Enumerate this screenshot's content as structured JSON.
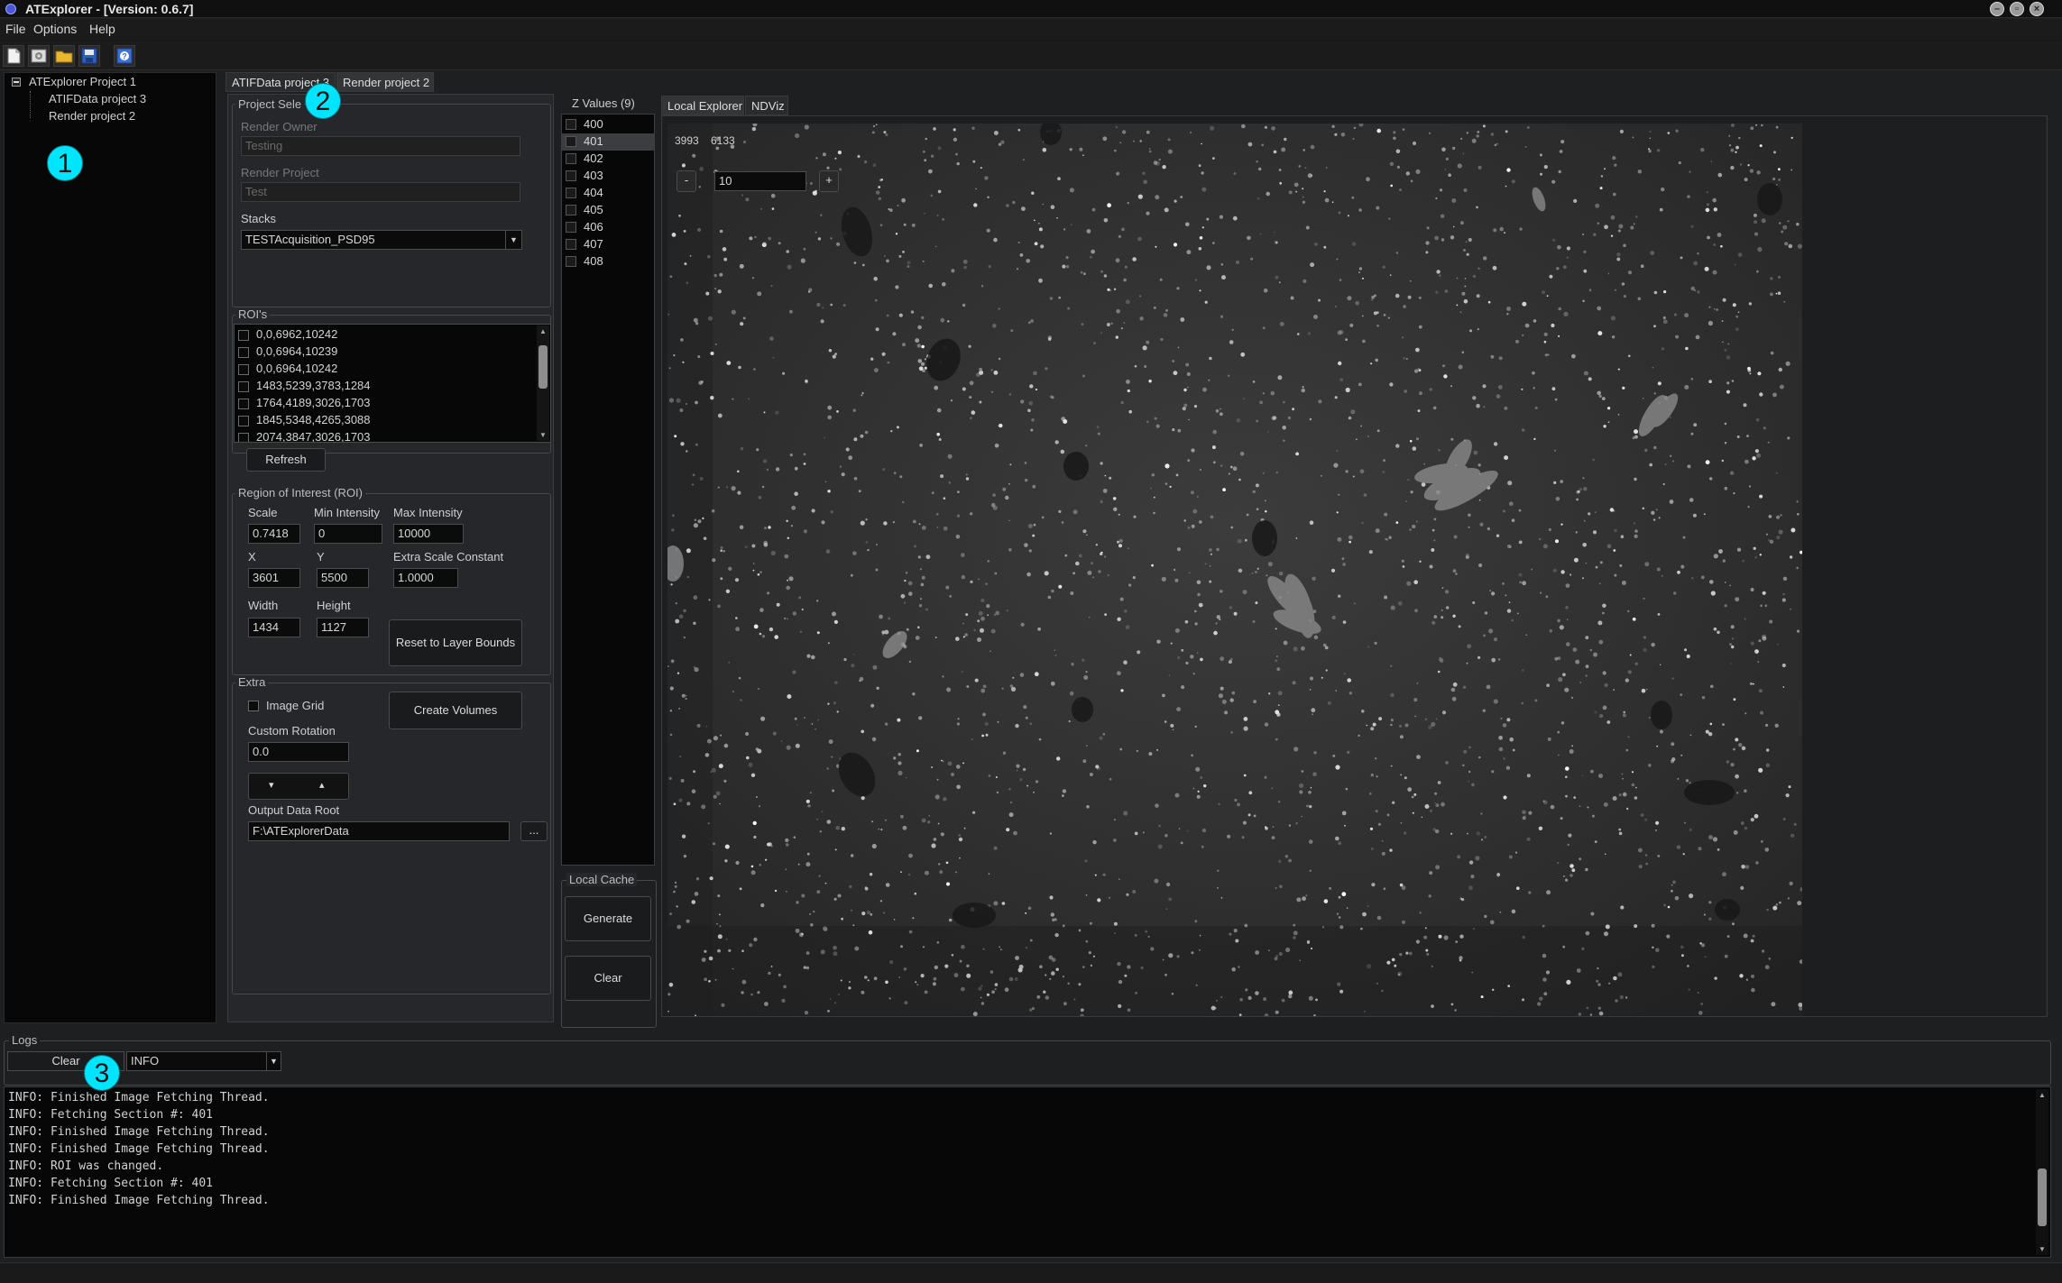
{
  "window": {
    "title": "ATExplorer - [Version: 0.6.7]"
  },
  "menu": [
    "File",
    "Options",
    "Help"
  ],
  "toolbar": {
    "icons": [
      "new-file-icon",
      "settings-icon",
      "open-folder-icon",
      "save-icon",
      "help-icon"
    ]
  },
  "tree": {
    "root": "ATExplorer Project 1",
    "children": [
      "ATIFData project 3",
      "Render project 2"
    ]
  },
  "project_tabs": [
    "ATIFData project 3",
    "Render project 2"
  ],
  "project_selection": {
    "title": "Project Sele",
    "owner_label": "Render Owner",
    "owner_value": "Testing",
    "project_label": "Render Project",
    "project_value": "Test",
    "stacks_label": "Stacks",
    "stacks_value": "TESTAcquisition_PSD95"
  },
  "rois": {
    "title": "ROI's",
    "items": [
      "0,0,6962,10242",
      "0,0,6964,10239",
      "0,0,6964,10242",
      "1483,5239,3783,1284",
      "1764,4189,3026,1703",
      "1845,5348,4265,3088",
      "2074,3847,3026,1703"
    ],
    "refresh_label": "Refresh"
  },
  "roi_region": {
    "title": "Region of Interest (ROI)",
    "scale_label": "Scale",
    "scale_value": "0.7418",
    "min_label": "Min Intensity",
    "min_value": "0",
    "max_label": "Max Intensity",
    "max_value": "10000",
    "x_label": "X",
    "x_value": "3601",
    "y_label": "Y",
    "y_value": "5500",
    "esc_label": "Extra Scale Constant",
    "esc_value": "1.0000",
    "width_label": "Width",
    "width_value": "1434",
    "height_label": "Height",
    "height_value": "1127",
    "reset_label": "Reset to Layer Bounds"
  },
  "extra": {
    "title": "Extra",
    "grid_label": "Image Grid",
    "create_label": "Create Volumes",
    "rotation_label": "Custom Rotation",
    "rotation_value": "0.0",
    "down_glyph": "▾",
    "up_glyph": "▴",
    "output_label": "Output Data Root",
    "output_value": "F:\\ATExplorerData",
    "browse_label": "..."
  },
  "z_values": {
    "title": "Z Values (9)",
    "items": [
      "400",
      "401",
      "402",
      "403",
      "404",
      "405",
      "406",
      "407",
      "408"
    ],
    "selected": "401"
  },
  "local_cache": {
    "title": "Local Cache",
    "generate_label": "Generate",
    "clear_label": "Clear"
  },
  "viewer": {
    "tabs": [
      "Local Explorer",
      "NDViz"
    ],
    "coord_x": "3993",
    "coord_y": "6133",
    "zoom_minus": "-",
    "zoom_value": "10",
    "zoom_plus": "+"
  },
  "logs": {
    "title": "Logs",
    "clear_label": "Clear",
    "level_value": "INFO",
    "lines": [
      "INFO: Finished Image Fetching Thread.",
      "INFO: Fetching Section #: 401",
      "INFO: Finished Image Fetching Thread.",
      "INFO: Finished Image Fetching Thread.",
      "INFO: ROI was changed.",
      "INFO: Fetching Section #: 401",
      "INFO: Finished Image Fetching Thread."
    ]
  },
  "callouts": [
    "1",
    "2",
    "3"
  ],
  "colors": {
    "callout": "#00e5ff",
    "background": "#1e1f20",
    "panel": "#25272a",
    "list_bg": "#070707"
  }
}
